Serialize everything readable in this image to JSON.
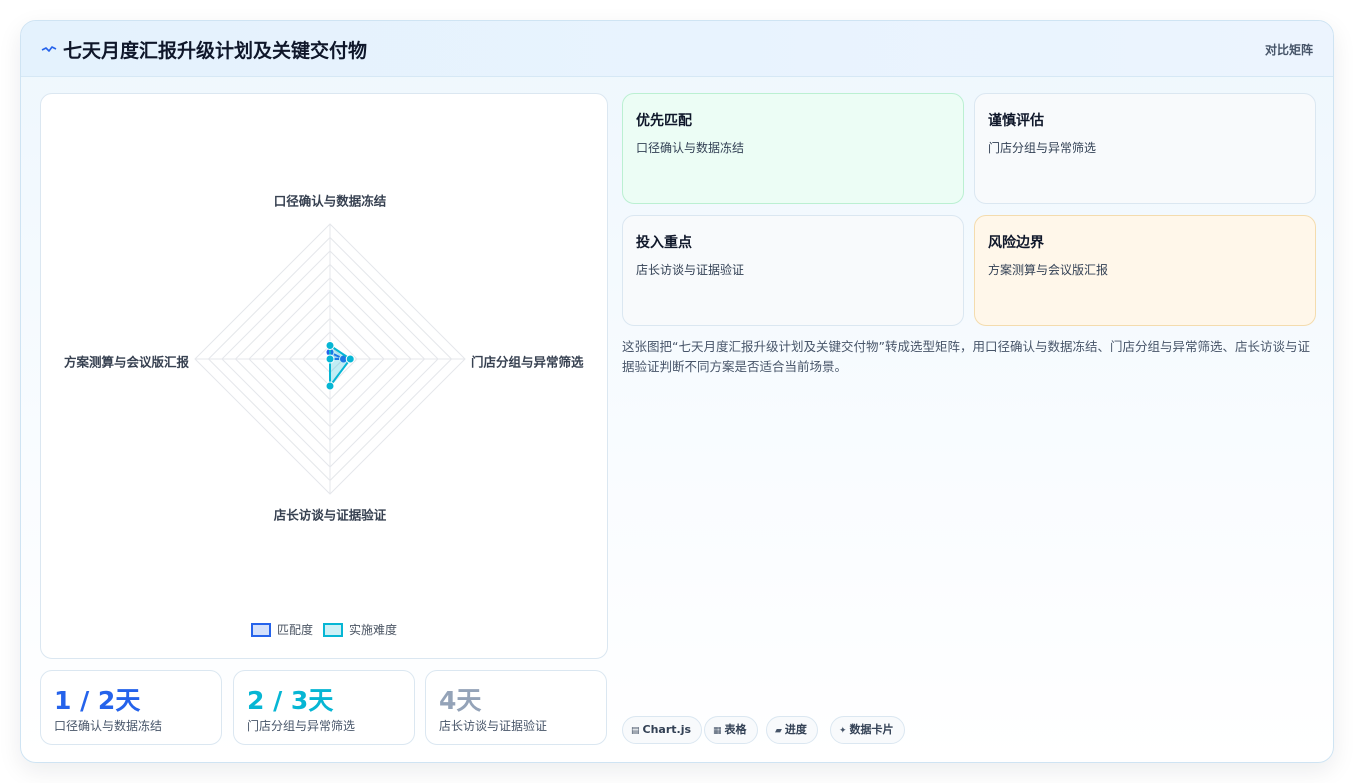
{
  "header": {
    "title": "七天月度汇报升级计划及关键交付物",
    "right_label": "对比矩阵",
    "icon": "spark-line-icon"
  },
  "chart_data": {
    "type": "radar",
    "categories": [
      "口径确认与数据冻结",
      "门店分组与异常筛选",
      "店长访谈与证据验证",
      "方案测算与会议版汇报"
    ],
    "series": [
      {
        "name": "匹配度",
        "values": [
          1,
          2,
          0,
          0
        ],
        "color": "#2563eb"
      },
      {
        "name": "实施难度",
        "values": [
          2,
          3,
          4,
          0
        ],
        "color": "#06b6d4"
      }
    ],
    "r_range": [
      0,
      20
    ],
    "grid": true,
    "legend_position": "bottom"
  },
  "stats": [
    {
      "value": "1 / 2天",
      "label": "口径确认与数据冻结",
      "color": "#2563eb"
    },
    {
      "value": "2 / 3天",
      "label": "门店分组与异常筛选",
      "color": "#06b6d4"
    },
    {
      "value": "4天",
      "label": "店长访谈与证据验证",
      "color": "#94a3b8"
    }
  ],
  "tiles": [
    {
      "title": "优先匹配",
      "sub": "口径确认与数据冻结"
    },
    {
      "title": "谨慎评估",
      "sub": "门店分组与异常筛选"
    },
    {
      "title": "投入重点",
      "sub": "店长访谈与证据验证"
    },
    {
      "title": "风险边界",
      "sub": "方案测算与会议版汇报"
    }
  ],
  "description": "这张图把“七天月度汇报升级计划及关键交付物”转成选型矩阵，用口径确认与数据冻结、门店分组与异常筛选、店长访谈与证据验证判断不同方案是否适合当前场景。",
  "chips": [
    {
      "icon": "chart-icon",
      "label": "Chart.js"
    },
    {
      "icon": "table-icon",
      "label": "表格"
    },
    {
      "icon": "progress-icon",
      "label": "进度"
    },
    {
      "icon": "sparkle-icon",
      "label": "数据卡片"
    }
  ]
}
